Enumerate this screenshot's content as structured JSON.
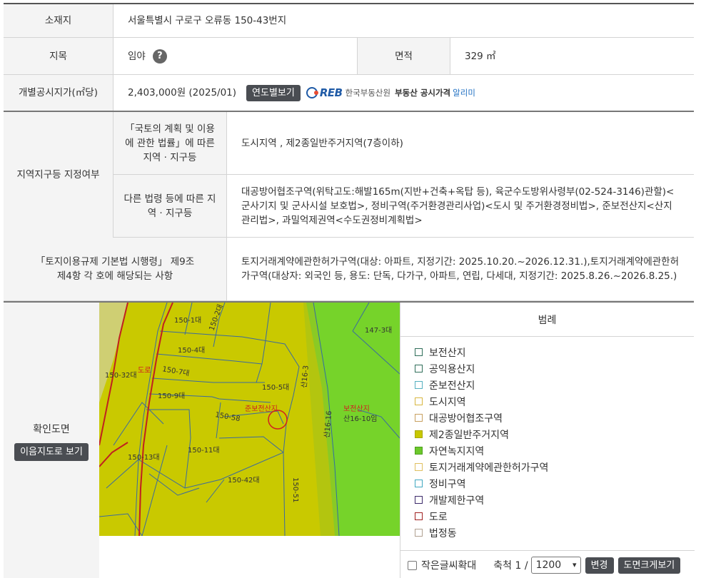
{
  "location": {
    "label": "소재지",
    "value": "서울특별시 구로구 오류동 150-43번지"
  },
  "land_category": {
    "label": "지목",
    "value": "임야",
    "help": "?"
  },
  "area": {
    "label": "면적",
    "value": "329 ㎡"
  },
  "price": {
    "label": "개별공시지가(㎡당)",
    "value": "2,403,000원 (2025/01)",
    "button": "연도별보기"
  },
  "reb": {
    "logo": "REB",
    "org": "한국부동산원",
    "service": "부동산 공시가격",
    "service_hl": "알리미"
  },
  "zoning": {
    "label": "지역지구등 지정여부",
    "national_label": "「국토의 계획 및 이용에 관한 법률」에 따른 지역 · 지구등",
    "national_value": "도시지역 , 제2종일반주거지역(7층이하)",
    "other_label": "다른 법령 등에 따른 지역 · 지구등",
    "other_value": "대공방어협조구역(위탁고도:해발165m(지반+건축+옥탑 등), 육군수도방위사령부(02-524-3146)관할)<군사기지 및 군사시설 보호법>, 정비구역(주거환경관리사업)<도시 및 주거환경정비법>, 준보전산지<산지관리법>, 과밀억제권역<수도권정비계획법>"
  },
  "regulation": {
    "label": "「토지이용규제 기본법 시행령」 제9조 제4항 각 호에 해당되는 사항",
    "value": "토지거래계약에관한허가구역(대상: 아파트, 지정기간: 2025.10.20.~2026.12.31.),토지거래계약에관한허가구역(대상자: 외국인 등, 용도: 단독, 다가구, 아파트, 연립, 다세대, 지정기간: 2025.8.26.~2026.8.25.)"
  },
  "confirm_map": {
    "label": "확인도면",
    "button": "이음지도로 보기"
  },
  "map_labels": {
    "l1": "150-1대",
    "l2": "150-2대",
    "l3": "147-3대",
    "l4": "150-4대",
    "l5": "150-7대",
    "l6": "150-32대",
    "l7": "도로",
    "l8": "150-9대",
    "l9": "150-5대",
    "l10": "준보전산지",
    "l11": "보전산지",
    "l12": "산16-10임",
    "l13": "150-13대",
    "l14": "150-11대",
    "l15": "150-42대",
    "l16": "150-51",
    "l17": "150-58",
    "l18": "산16-3",
    "l19": "산16-16"
  },
  "legend": {
    "title": "범례",
    "items": [
      {
        "label": "보전산지",
        "color": "#2f6e5a",
        "fill": "#ffffff"
      },
      {
        "label": "공익용산지",
        "color": "#2f6e5a",
        "fill": "#ffffff"
      },
      {
        "label": "준보전산지",
        "color": "#55b0c0",
        "fill": "#ffffff"
      },
      {
        "label": "도시지역",
        "color": "#d8b640",
        "fill": "#ffffff"
      },
      {
        "label": "대공방어협조구역",
        "color": "#c8a060",
        "fill": "#ffffff"
      },
      {
        "label": "제2종일반주거지역",
        "color": "#a8a800",
        "fill": "#c8c800"
      },
      {
        "label": "자연녹지지역",
        "color": "#4ca01c",
        "fill": "#6cc82c"
      },
      {
        "label": "토지거래계약에관한허가구역",
        "color": "#e0c060",
        "fill": "#ffffff"
      },
      {
        "label": "정비구역",
        "color": "#40a8c0",
        "fill": "#ffffff"
      },
      {
        "label": "개발제한구역",
        "color": "#3c2a6a",
        "fill": "#ffffff"
      },
      {
        "label": "도로",
        "color": "#a02020",
        "fill": "#ffffff"
      },
      {
        "label": "법정동",
        "color": "#b0a090",
        "fill": "#ffffff"
      }
    ]
  },
  "footer": {
    "checkbox_label": "작은글씨확대",
    "scale_label": "축척 1 /",
    "scale_value": "1200",
    "change_button": "변경",
    "large_button": "도면크게보기"
  }
}
